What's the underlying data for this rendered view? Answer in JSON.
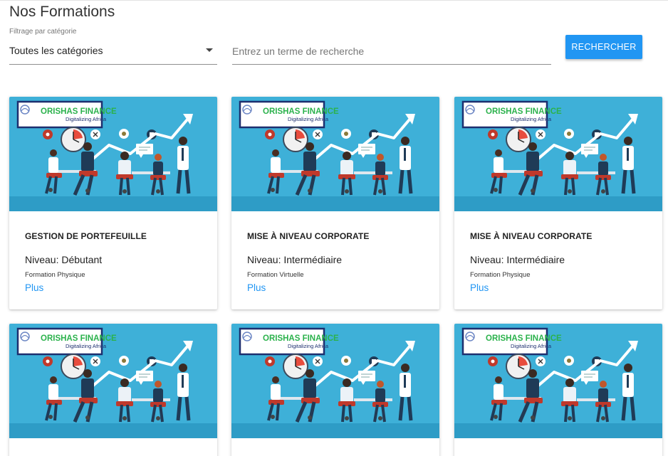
{
  "page": {
    "title": "Nos Formations"
  },
  "filters": {
    "category_label": "Filtrage par catégorie",
    "category_value": "Toutes les catégories",
    "search_placeholder": "Entrez un terme de recherche",
    "search_value": "",
    "search_button": "RECHERCHER"
  },
  "brand": {
    "logo_main": "ORISHAS FINANCE",
    "logo_tagline": "Digitalizing Africa"
  },
  "colors": {
    "accent": "#2196f3",
    "card_image_bg": "#3eb0d8",
    "logo_green": "#2bb24c",
    "logo_navy": "#1d2f6f"
  },
  "icons": [
    "chevron-down-icon",
    "logo-hand-icon",
    "badge-icon",
    "clock-icon",
    "growth-arrow-icon",
    "speech-bubble-icon"
  ],
  "cards": [
    {
      "title": "GESTION DE PORTEFEUILLE",
      "level": "Niveau: Débutant",
      "type": "Formation Physique",
      "more": "Plus"
    },
    {
      "title": "MISE À NIVEAU CORPORATE",
      "level": "Niveau: Intermédiaire",
      "type": "Formation Virtuelle",
      "more": "Plus"
    },
    {
      "title": "MISE À NIVEAU CORPORATE",
      "level": "Niveau: Intermédiaire",
      "type": "Formation Physique",
      "more": "Plus"
    },
    {
      "title": "",
      "level": "",
      "type": "",
      "more": ""
    },
    {
      "title": "",
      "level": "",
      "type": "",
      "more": ""
    },
    {
      "title": "",
      "level": "",
      "type": "",
      "more": ""
    }
  ]
}
